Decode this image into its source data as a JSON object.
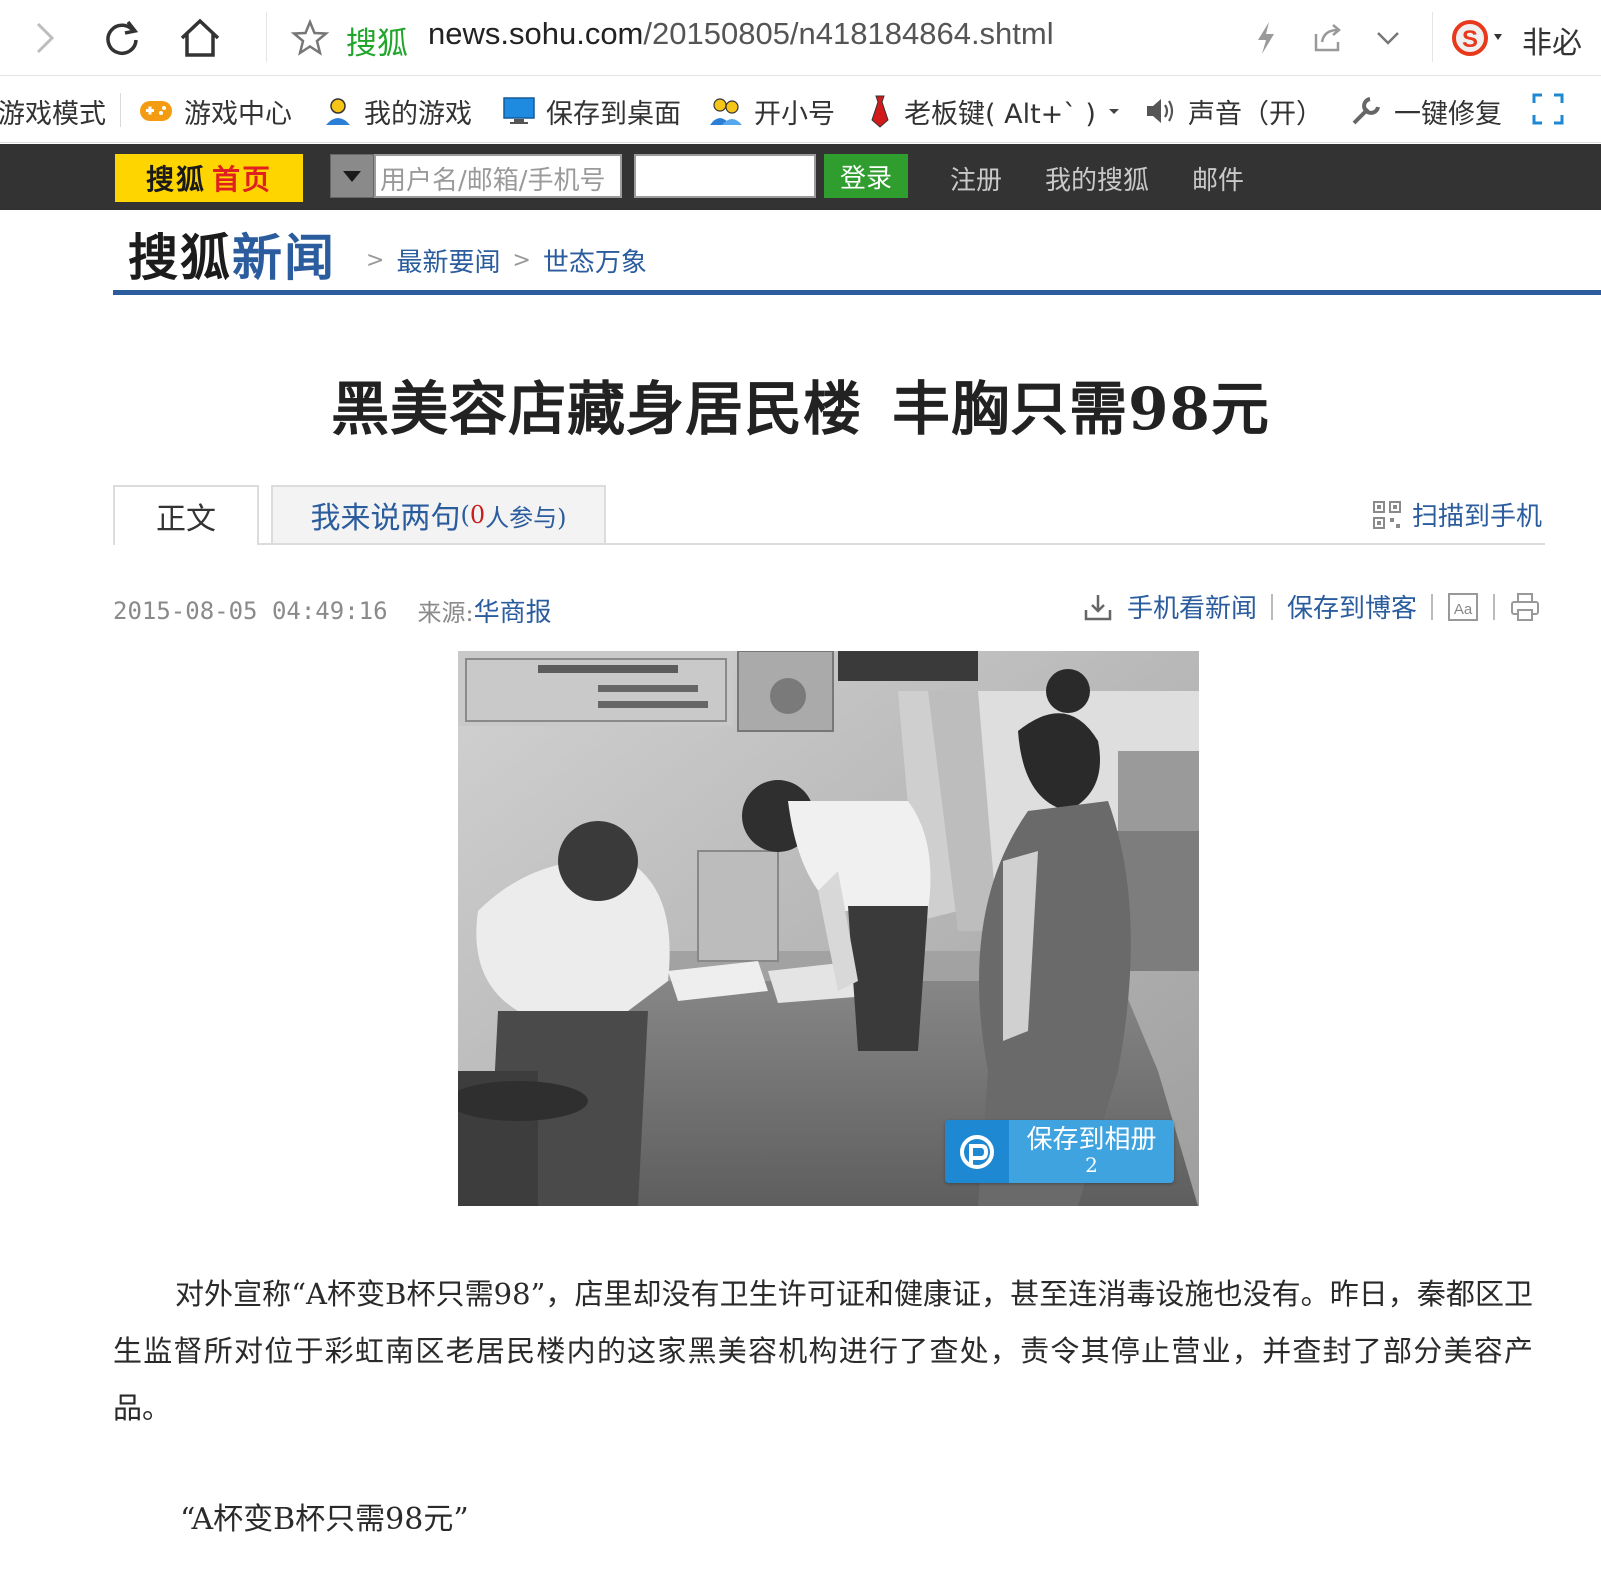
{
  "browser": {
    "site_tag": "搜狐",
    "url_domain": "news.sohu.com",
    "url_path": "/20150805/n418184864.shtml",
    "extra_label": "非必"
  },
  "toolbar": {
    "items": [
      {
        "label": "游戏模式",
        "icon": "game-mode-icon"
      },
      {
        "label": "游戏中心",
        "icon": "gamepad-icon"
      },
      {
        "label": "我的游戏",
        "icon": "user-icon"
      },
      {
        "label": "保存到桌面",
        "icon": "monitor-icon"
      },
      {
        "label": "开小号",
        "icon": "users-icon"
      },
      {
        "label": "老板键( Alt+` )",
        "icon": "tie-icon"
      },
      {
        "label": "声音（开）",
        "icon": "speaker-icon"
      },
      {
        "label": "一键修复",
        "icon": "wrench-icon"
      }
    ]
  },
  "sohu_bar": {
    "logo_black": "搜狐",
    "logo_red": "首页",
    "username_placeholder": "用户名/邮箱/手机号",
    "login_label": "登录",
    "links": [
      "注册",
      "我的搜狐",
      "邮件"
    ]
  },
  "news_header": {
    "logo_part1": "搜狐",
    "logo_part2": "新闻",
    "breadcrumb": [
      "最新要闻",
      "世态万象"
    ]
  },
  "article": {
    "title_part1": "黑美容店藏身居民楼",
    "title_part2": "丰胸只需98元",
    "tab_main": "正文",
    "tab_comment": "我来说两句",
    "tab_comment_open": "(",
    "tab_comment_count": "0",
    "tab_comment_suffix": "人参与)",
    "scan_label": "扫描到手机",
    "datetime": "2015-08-05 04:49:16",
    "source_label": "来源:",
    "source": "华商报",
    "tools": [
      "手机看新闻",
      "保存到博客"
    ],
    "save_album_label": "保存到相册",
    "save_album_count": "2",
    "paragraph1": "对外宣称“A杯变B杯只需98”，店里却没有卫生许可证和健康证，甚至连消毒设施也没有。昨日，秦都区卫生监督所对位于彩虹南区老居民楼内的这家黑美容机构进行了查处，责令其停止营业，并查封了部分美容产品。",
    "subhead": "“A杯变B杯只需98元”"
  },
  "colors": {
    "sohu_blue": "#2b5c9e",
    "sohu_yellow": "#ffd500",
    "login_green": "#2f9e2f",
    "site_tag_green": "#21a52a",
    "top_bar_dark": "#333333"
  }
}
